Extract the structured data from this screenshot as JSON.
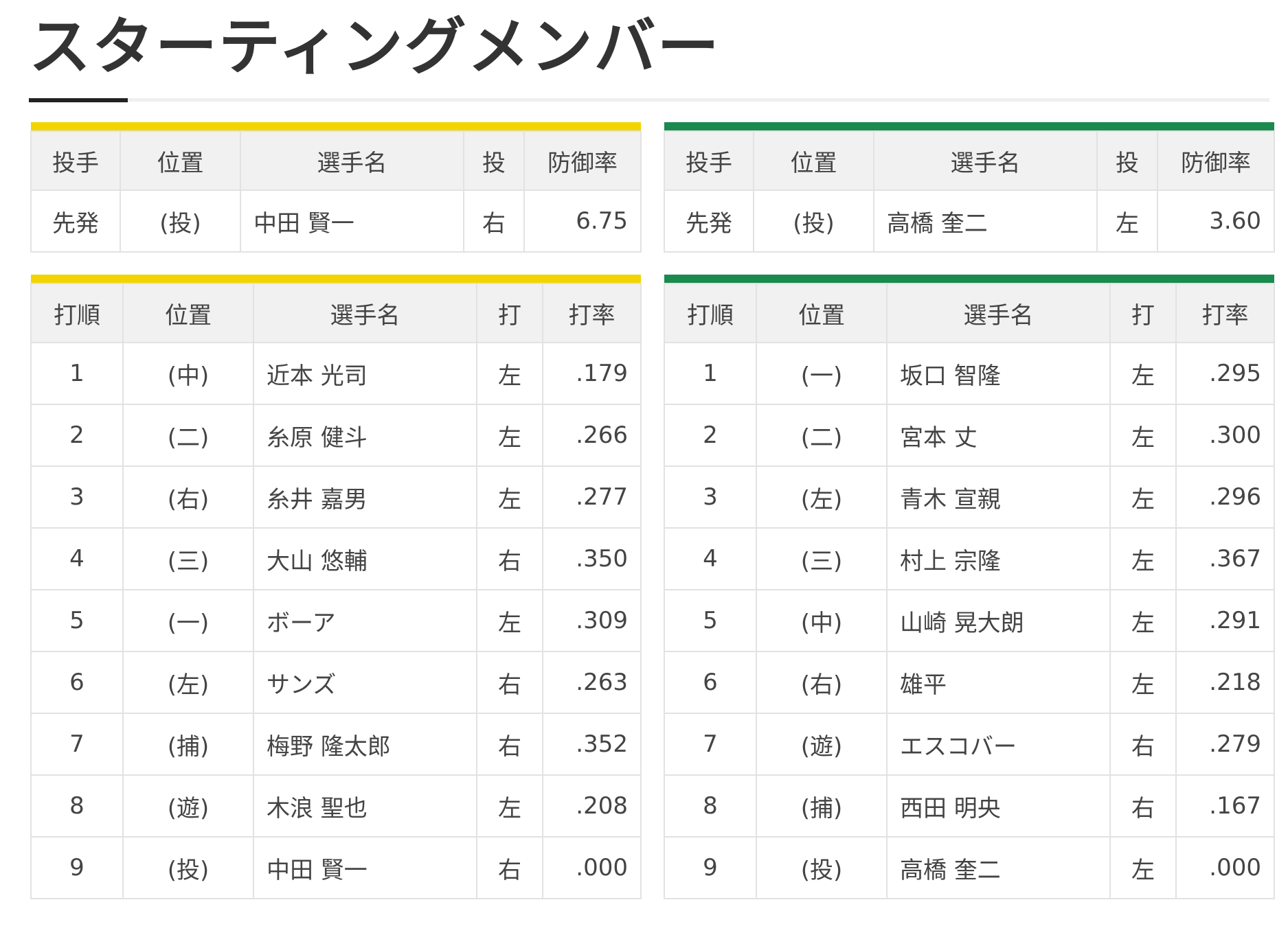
{
  "page": {
    "title": "スターティングメンバー"
  },
  "colors": {
    "home_accent": "#f2d500",
    "away_accent": "#1a8a4e",
    "name_link": "#1a4fbf",
    "header_bg": "#f1f1f1"
  },
  "home": {
    "pitcher": {
      "headers": [
        "投手",
        "位置",
        "選手名",
        "投",
        "防御率"
      ],
      "row": {
        "role": "先発",
        "pos": "(投)",
        "name": "中田 賢一",
        "hand": "右",
        "era": "6.75"
      }
    },
    "batting": {
      "headers": [
        "打順",
        "位置",
        "選手名",
        "打",
        "打率"
      ],
      "rows": [
        {
          "order": "1",
          "pos": "(中)",
          "name": "近本 光司",
          "hand": "左",
          "avg": ".179"
        },
        {
          "order": "2",
          "pos": "(二)",
          "name": "糸原 健斗",
          "hand": "左",
          "avg": ".266"
        },
        {
          "order": "3",
          "pos": "(右)",
          "name": "糸井 嘉男",
          "hand": "左",
          "avg": ".277"
        },
        {
          "order": "4",
          "pos": "(三)",
          "name": "大山 悠輔",
          "hand": "右",
          "avg": ".350"
        },
        {
          "order": "5",
          "pos": "(一)",
          "name": "ボーア",
          "hand": "左",
          "avg": ".309"
        },
        {
          "order": "6",
          "pos": "(左)",
          "name": "サンズ",
          "hand": "右",
          "avg": ".263"
        },
        {
          "order": "7",
          "pos": "(捕)",
          "name": "梅野 隆太郎",
          "hand": "右",
          "avg": ".352"
        },
        {
          "order": "8",
          "pos": "(遊)",
          "name": "木浪 聖也",
          "hand": "左",
          "avg": ".208"
        },
        {
          "order": "9",
          "pos": "(投)",
          "name": "中田 賢一",
          "hand": "右",
          "avg": ".000"
        }
      ]
    }
  },
  "away": {
    "pitcher": {
      "headers": [
        "投手",
        "位置",
        "選手名",
        "投",
        "防御率"
      ],
      "row": {
        "role": "先発",
        "pos": "(投)",
        "name": "高橋 奎二",
        "hand": "左",
        "era": "3.60"
      }
    },
    "batting": {
      "headers": [
        "打順",
        "位置",
        "選手名",
        "打",
        "打率"
      ],
      "rows": [
        {
          "order": "1",
          "pos": "(一)",
          "name": "坂口 智隆",
          "hand": "左",
          "avg": ".295"
        },
        {
          "order": "2",
          "pos": "(二)",
          "name": "宮本 丈",
          "hand": "左",
          "avg": ".300"
        },
        {
          "order": "3",
          "pos": "(左)",
          "name": "青木 宣親",
          "hand": "左",
          "avg": ".296"
        },
        {
          "order": "4",
          "pos": "(三)",
          "name": "村上 宗隆",
          "hand": "左",
          "avg": ".367"
        },
        {
          "order": "5",
          "pos": "(中)",
          "name": "山崎 晃大朗",
          "hand": "左",
          "avg": ".291"
        },
        {
          "order": "6",
          "pos": "(右)",
          "name": "雄平",
          "hand": "左",
          "avg": ".218"
        },
        {
          "order": "7",
          "pos": "(遊)",
          "name": "エスコバー",
          "hand": "右",
          "avg": ".279"
        },
        {
          "order": "8",
          "pos": "(捕)",
          "name": "西田 明央",
          "hand": "右",
          "avg": ".167"
        },
        {
          "order": "9",
          "pos": "(投)",
          "name": "高橋 奎二",
          "hand": "左",
          "avg": ".000"
        }
      ]
    }
  }
}
